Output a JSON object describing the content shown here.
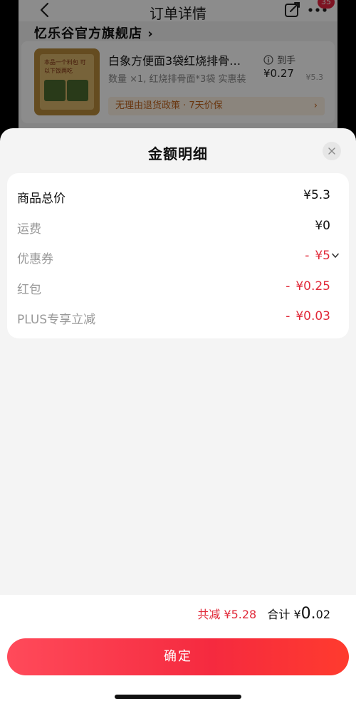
{
  "background_page": {
    "nav": {
      "title": "订单详情",
      "badge": "35"
    },
    "store_name": "忆乐谷官方旗舰店",
    "product": {
      "title": "白象方便面3袋红烧排骨…",
      "spec": "数量 ×1, 红烧排骨面*3袋 实惠装",
      "price_label": "到手",
      "price_final": "¥0.27",
      "price_original": "¥5.3",
      "thumb_caption": "本品一个料包 可以下饭两吃",
      "policy": "无理由退货政策 · 7天价保"
    }
  },
  "sheet": {
    "title": "金额明细",
    "rows": [
      {
        "label": "商品总价",
        "value": "¥5.3"
      },
      {
        "label": "运费",
        "value": "¥0"
      },
      {
        "label": "优惠券",
        "value": "¥5",
        "sign": "-"
      },
      {
        "label": "红包",
        "value": "¥0.25",
        "sign": "-"
      },
      {
        "label": "PLUS专享立减",
        "value": "¥0.03",
        "sign": "-"
      }
    ]
  },
  "summary": {
    "reduce_text": "共减 ¥5.28",
    "total_label": "合计",
    "total_yen": "¥",
    "total_int": "0.",
    "total_dec": "02"
  },
  "footer": {
    "confirm_label": "确定"
  },
  "colors": {
    "accent_red": "#e12a3a",
    "button_gradient_start": "#ff4a5a",
    "button_gradient_end": "#ff3b2e"
  }
}
